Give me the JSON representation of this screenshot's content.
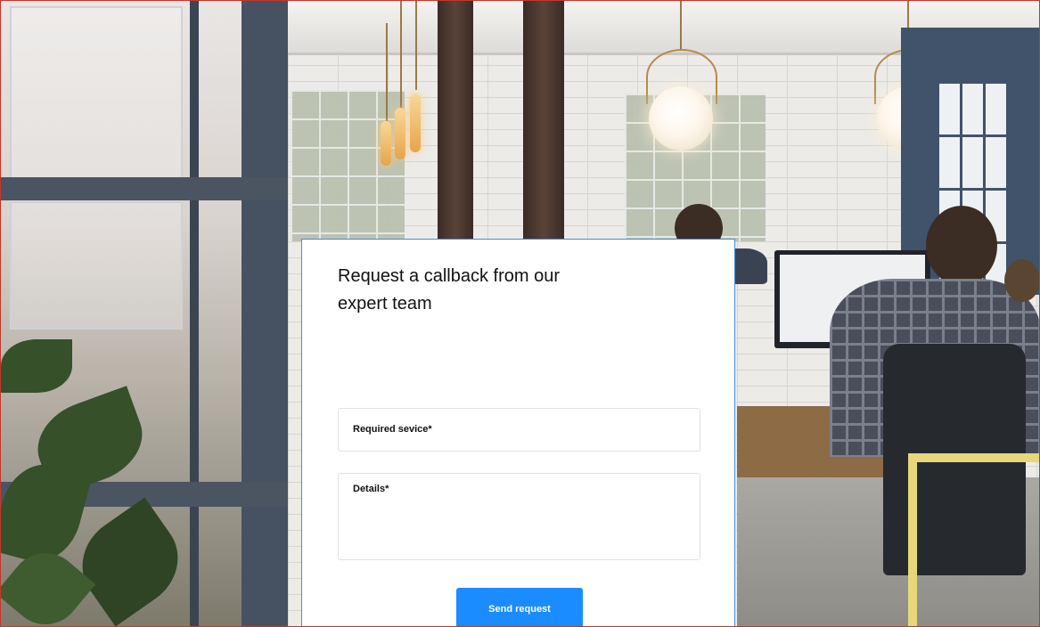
{
  "form": {
    "title": "Request a callback from our expert team",
    "fields": {
      "service": {
        "label": "Required sevice*",
        "value": ""
      },
      "details": {
        "label": "Details*",
        "value": ""
      }
    },
    "submit_label": "Send request"
  },
  "colors": {
    "accent": "#1a8cff",
    "card_border": "#3d8fe0",
    "frame_border": "#c0392b"
  }
}
